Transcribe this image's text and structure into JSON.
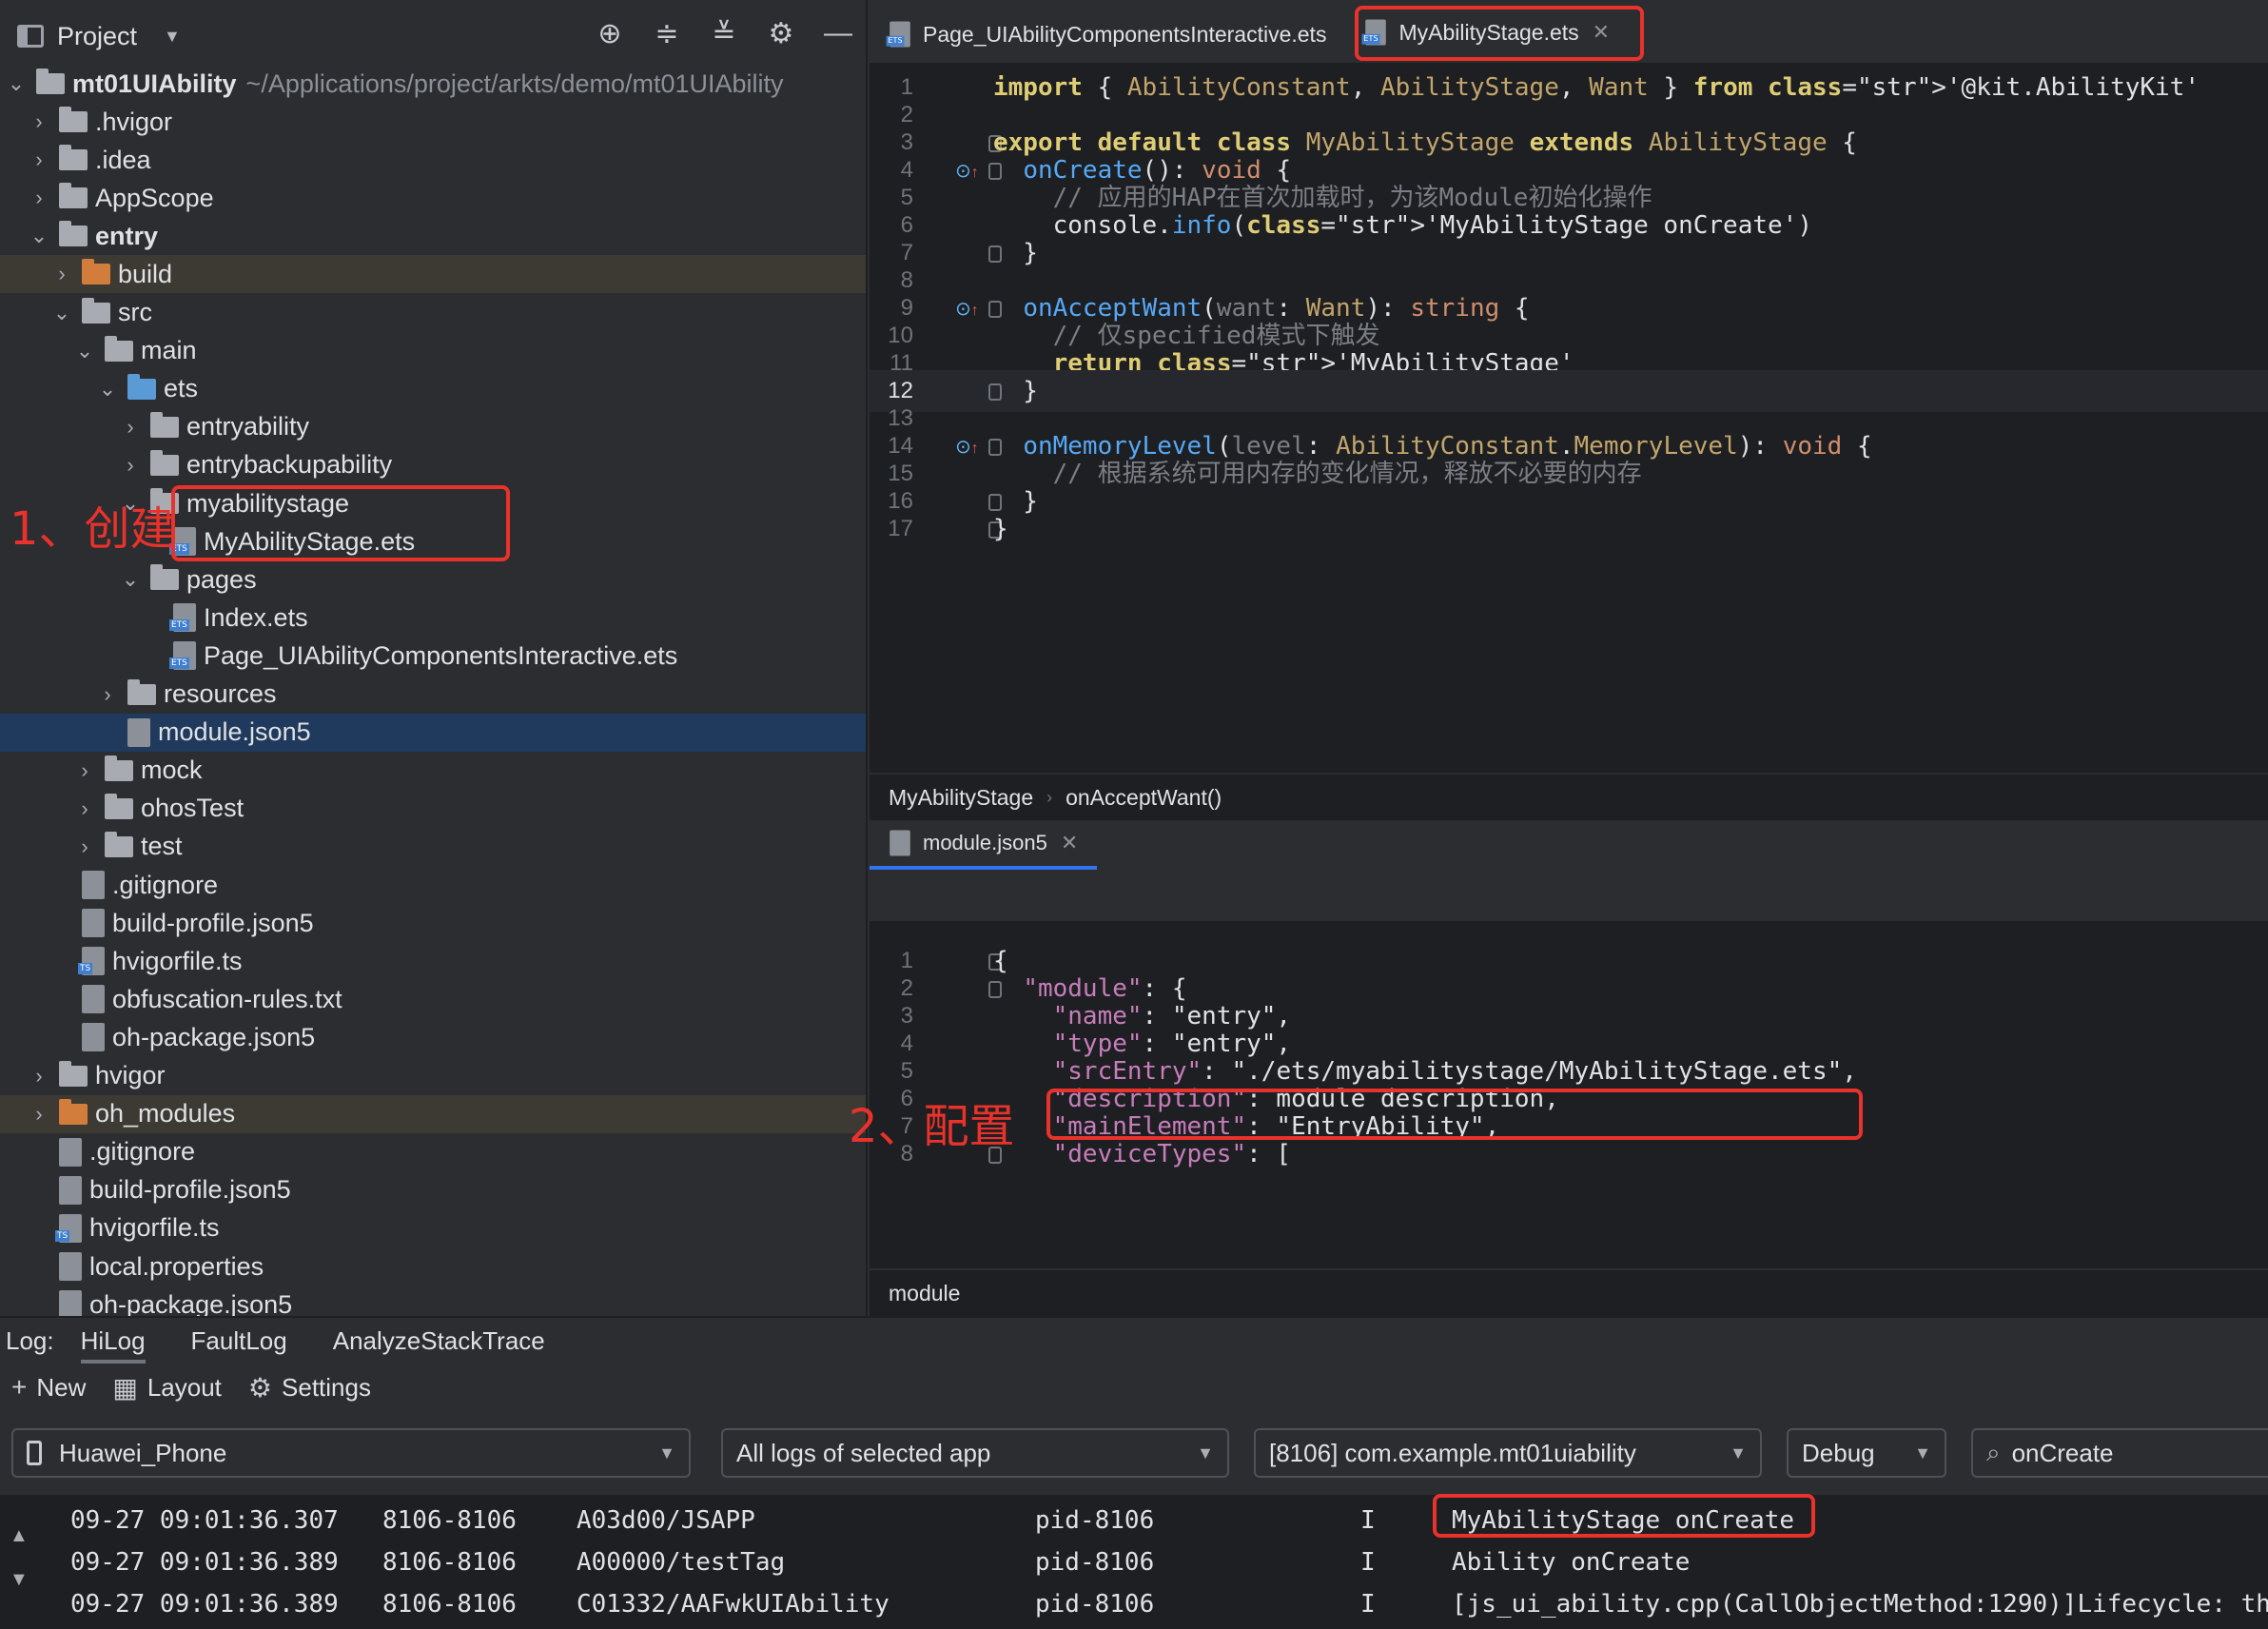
{
  "project_panel": {
    "title": "Project",
    "root": {
      "name": "mt01UIAbility",
      "path": "~/Applications/project/arkts/demo/mt01UIAbility"
    },
    "tree": [
      {
        "label": ".hvigor"
      },
      {
        "label": ".idea"
      },
      {
        "label": "AppScope"
      },
      {
        "label": "entry"
      },
      {
        "label": "build"
      },
      {
        "label": "src"
      },
      {
        "label": "main"
      },
      {
        "label": "ets"
      },
      {
        "label": "entryability"
      },
      {
        "label": "entrybackupability"
      },
      {
        "label": "myabilitystage"
      },
      {
        "label": "MyAbilityStage.ets"
      },
      {
        "label": "pages"
      },
      {
        "label": "Index.ets"
      },
      {
        "label": "Page_UIAbilityComponentsInteractive.ets"
      },
      {
        "label": "resources"
      },
      {
        "label": "module.json5"
      },
      {
        "label": "mock"
      },
      {
        "label": "ohosTest"
      },
      {
        "label": "test"
      },
      {
        "label": ".gitignore"
      },
      {
        "label": "build-profile.json5"
      },
      {
        "label": "hvigorfile.ts"
      },
      {
        "label": "obfuscation-rules.txt"
      },
      {
        "label": "oh-package.json5"
      },
      {
        "label": "hvigor"
      },
      {
        "label": "oh_modules"
      },
      {
        "label": ".gitignore"
      },
      {
        "label": "build-profile.json5"
      },
      {
        "label": "hvigorfile.ts"
      },
      {
        "label": "local.properties"
      },
      {
        "label": "oh-package.json5"
      }
    ]
  },
  "editor": {
    "tabs": [
      "Page_UIAbilityComponentsInteractive.ets",
      "MyAbilityStage.ets"
    ],
    "code_lines": [
      {
        "n": "1",
        "t": "import { AbilityConstant, AbilityStage, Want } from '@kit.AbilityKit'"
      },
      {
        "n": "2",
        "t": ""
      },
      {
        "n": "3",
        "t": "export default class MyAbilityStage extends AbilityStage {"
      },
      {
        "n": "4",
        "t": "  onCreate(): void {"
      },
      {
        "n": "5",
        "t": "    // 应用的HAP在首次加载时，为该Module初始化操作"
      },
      {
        "n": "6",
        "t": "    console.info('MyAbilityStage onCreate')"
      },
      {
        "n": "7",
        "t": "  }"
      },
      {
        "n": "8",
        "t": ""
      },
      {
        "n": "9",
        "t": "  onAcceptWant(want: Want): string {"
      },
      {
        "n": "10",
        "t": "    // 仅specified模式下触发"
      },
      {
        "n": "11",
        "t": "    return 'MyAbilityStage'"
      },
      {
        "n": "12",
        "t": "  }"
      },
      {
        "n": "13",
        "t": ""
      },
      {
        "n": "14",
        "t": "  onMemoryLevel(level: AbilityConstant.MemoryLevel): void {"
      },
      {
        "n": "15",
        "t": "    // 根据系统可用内存的变化情况，释放不必要的内存"
      },
      {
        "n": "16",
        "t": "  }"
      },
      {
        "n": "17",
        "t": "}"
      }
    ],
    "breadcrumb": [
      "MyAbilityStage",
      "onAcceptWant()"
    ],
    "second_tab": "module.json5",
    "json_lines": [
      {
        "n": "1",
        "t": "{"
      },
      {
        "n": "2",
        "t": "  \"module\": {"
      },
      {
        "n": "3",
        "t": "    \"name\": \"entry\","
      },
      {
        "n": "4",
        "t": "    \"type\": \"entry\","
      },
      {
        "n": "5",
        "t": "    \"srcEntry\": \"./ets/myabilitystage/MyAbilityStage.ets\","
      },
      {
        "n": "6",
        "t": "    \"description\": module description,"
      },
      {
        "n": "7",
        "t": "    \"mainElement\": \"EntryAbility\","
      },
      {
        "n": "8",
        "t": "    \"deviceTypes\": ["
      }
    ],
    "breadcrumb2": "module"
  },
  "log_panel": {
    "label": "Log:",
    "tabs": [
      "HiLog",
      "FaultLog",
      "AnalyzeStackTrace"
    ],
    "toolbar": {
      "new": "New",
      "layout": "Layout",
      "settings": "Settings"
    },
    "filters": {
      "device": "Huawei_Phone",
      "scope": "All logs of selected app",
      "process": "[8106] com.example.mt01uiability",
      "level": "Debug",
      "search": "onCreate"
    },
    "rows": [
      {
        "time": "09-27 09:01:36.307",
        "pid": "8106-8106",
        "tag": "A03d00/JSAPP",
        "proc": "pid-8106",
        "level": "I",
        "msg": "MyAbilityStage onCreate"
      },
      {
        "time": "09-27 09:01:36.389",
        "pid": "8106-8106",
        "tag": "A00000/testTag",
        "proc": "pid-8106",
        "level": "I",
        "msg": "Ability onCreate"
      },
      {
        "time": "09-27 09:01:36.389",
        "pid": "8106-8106",
        "tag": "C01332/AAFwkUIAbility",
        "proc": "pid-8106",
        "level": "I",
        "msg": "[js_ui_ability.cpp(CallObjectMethod:1290)]Lifecycle: th"
      }
    ]
  },
  "annotations": {
    "step1": "1、创建",
    "step2": "2、配置"
  },
  "colors": {
    "annotation": "#e8322b",
    "accent": "#3574f0"
  }
}
